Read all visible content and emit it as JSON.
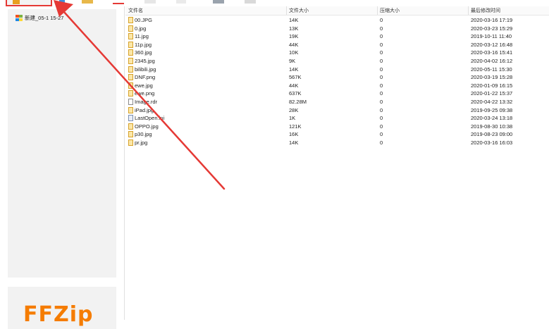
{
  "tree": {
    "item_label": "新建_05-1  15-27"
  },
  "logo": {
    "text": "FFZip"
  },
  "columns": {
    "name": "文件名",
    "size": "文件大小",
    "compressed": "压缩大小",
    "modified": "最后修改时间"
  },
  "files": [
    {
      "name": "00.JPG",
      "size": "14K",
      "compressed": "0",
      "modified": "2020-03-16 17:19",
      "icon": "image"
    },
    {
      "name": "0.jpg",
      "size": "13K",
      "compressed": "0",
      "modified": "2020-03-23 15:29",
      "icon": "image"
    },
    {
      "name": "11.jpg",
      "size": "19K",
      "compressed": "0",
      "modified": "2019-10-11 11:40",
      "icon": "image"
    },
    {
      "name": "11p.jpg",
      "size": "44K",
      "compressed": "0",
      "modified": "2020-03-12 16:48",
      "icon": "image"
    },
    {
      "name": "360.jpg",
      "size": "10K",
      "compressed": "0",
      "modified": "2020-03-16 15:41",
      "icon": "image"
    },
    {
      "name": "2345.jpg",
      "size": "9K",
      "compressed": "0",
      "modified": "2020-04-02 16:12",
      "icon": "image"
    },
    {
      "name": "bilibili.jpg",
      "size": "14K",
      "compressed": "0",
      "modified": "2020-05-11 15:30",
      "icon": "image"
    },
    {
      "name": "DNF.png",
      "size": "567K",
      "compressed": "0",
      "modified": "2020-03-19 15:28",
      "icon": "image"
    },
    {
      "name": "ewe.jpg",
      "size": "44K",
      "compressed": "0",
      "modified": "2020-01-09 16:15",
      "icon": "image"
    },
    {
      "name": "ewe.png",
      "size": "637K",
      "compressed": "0",
      "modified": "2020-01-22 15:37",
      "icon": "image"
    },
    {
      "name": "Image.rdr",
      "size": "82.28M",
      "compressed": "0",
      "modified": "2020-04-22 13:32",
      "icon": "doc"
    },
    {
      "name": "iPad.jpg",
      "size": "28K",
      "compressed": "0",
      "modified": "2019-09-25 09:38",
      "icon": "image"
    },
    {
      "name": "LastOpen.ini",
      "size": "1K",
      "compressed": "0",
      "modified": "2020-03-24 13:18",
      "icon": "ini"
    },
    {
      "name": "OPPO.jpg",
      "size": "121K",
      "compressed": "0",
      "modified": "2019-08-30 10:38",
      "icon": "image"
    },
    {
      "name": "p30.jpg",
      "size": "16K",
      "compressed": "0",
      "modified": "2019-08-23 09:00",
      "icon": "image"
    },
    {
      "name": "pr.jpg",
      "size": "14K",
      "compressed": "0",
      "modified": "2020-03-16 16:03",
      "icon": "image"
    }
  ],
  "colors": {
    "annotation": "#e53935",
    "folder": "#e8a020",
    "logo": "#f57c00"
  },
  "icons": [
    "add-archive-icon",
    "extract-icon",
    "folder-icon",
    "delete-icon",
    "view-icon",
    "edit-icon",
    "settings-icon",
    "info-icon"
  ]
}
